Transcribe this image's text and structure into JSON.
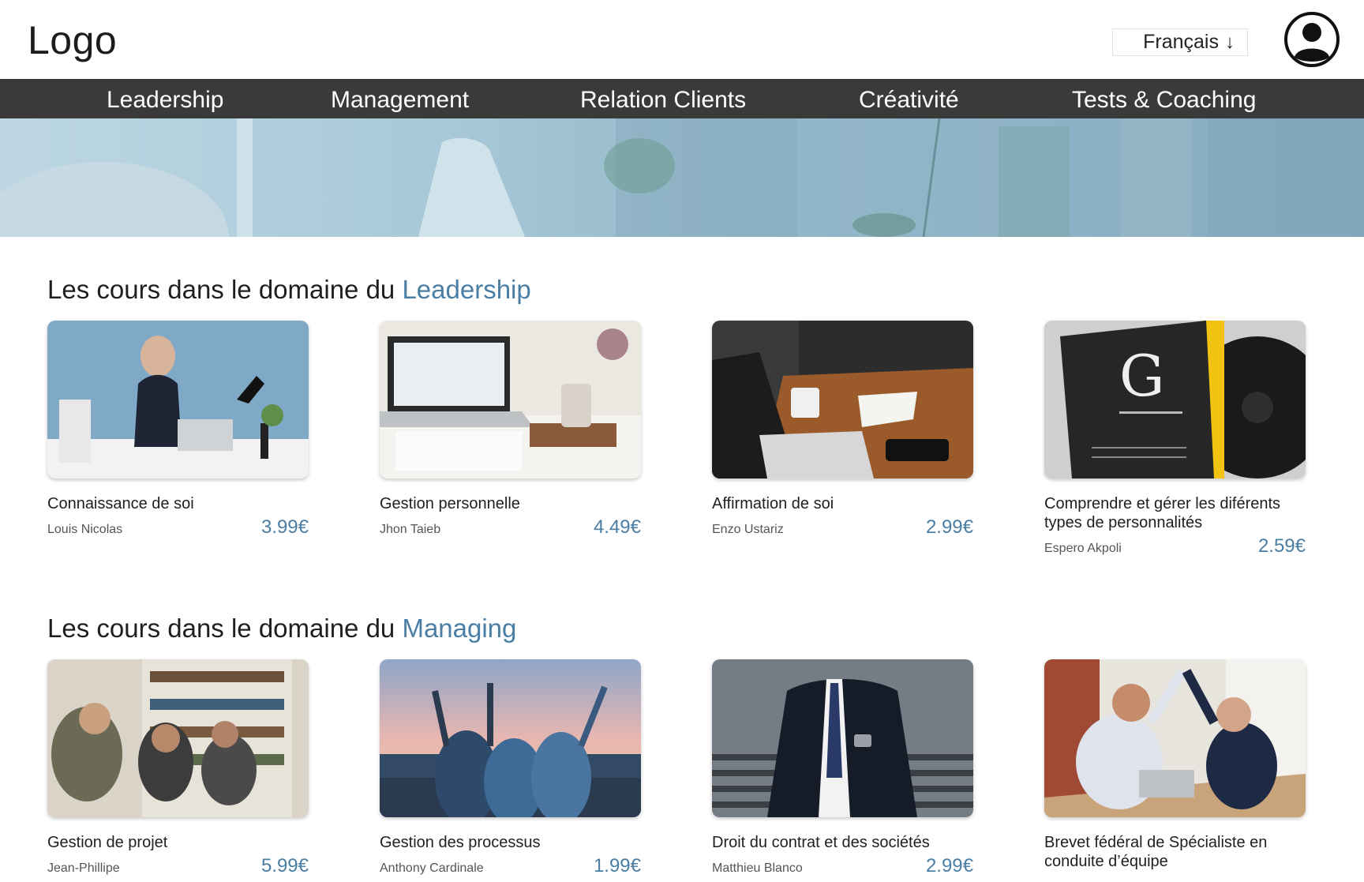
{
  "header": {
    "logo": "Logo",
    "language": {
      "selected": "Français",
      "arrow": "↓"
    },
    "avatar_icon": "user-circle-icon"
  },
  "nav": {
    "items": [
      {
        "label": "Leadership"
      },
      {
        "label": "Management"
      },
      {
        "label": "Relation Clients"
      },
      {
        "label": "Créativité"
      },
      {
        "label": "Tests & Coaching"
      }
    ]
  },
  "colors": {
    "accent": "#4a7ea4",
    "navbar": "#3a3a3a"
  },
  "sections": [
    {
      "title_prefix": "Les cours dans le domaine du",
      "title_accent": "Leadership",
      "courses": [
        {
          "title": "Connaissance de soi",
          "author": "Louis Nicolas",
          "price": "3.99€"
        },
        {
          "title": "Gestion personnelle",
          "author": "Jhon Taieb",
          "price": "4.49€"
        },
        {
          "title": "Affirmation de soi",
          "author": "Enzo Ustariz",
          "price": "2.99€"
        },
        {
          "title": "Comprendre et gérer les diférents types de personnalités",
          "author": "Espero Akpoli",
          "price": "2.59€"
        }
      ]
    },
    {
      "title_prefix": "Les cours dans le domaine du",
      "title_accent": "Managing",
      "courses": [
        {
          "title": "Gestion de projet",
          "author": "Jean-Phillipe",
          "price": "5.99€"
        },
        {
          "title": "Gestion des processus",
          "author": "Anthony Cardinale",
          "price": "1.99€"
        },
        {
          "title": "Droit du contrat et des sociétés",
          "author": "Matthieu Blanco",
          "price": "2.99€"
        },
        {
          "title": "Brevet fédéral de Spécialiste en conduite d’équipe",
          "author": "",
          "price": ""
        }
      ]
    }
  ]
}
